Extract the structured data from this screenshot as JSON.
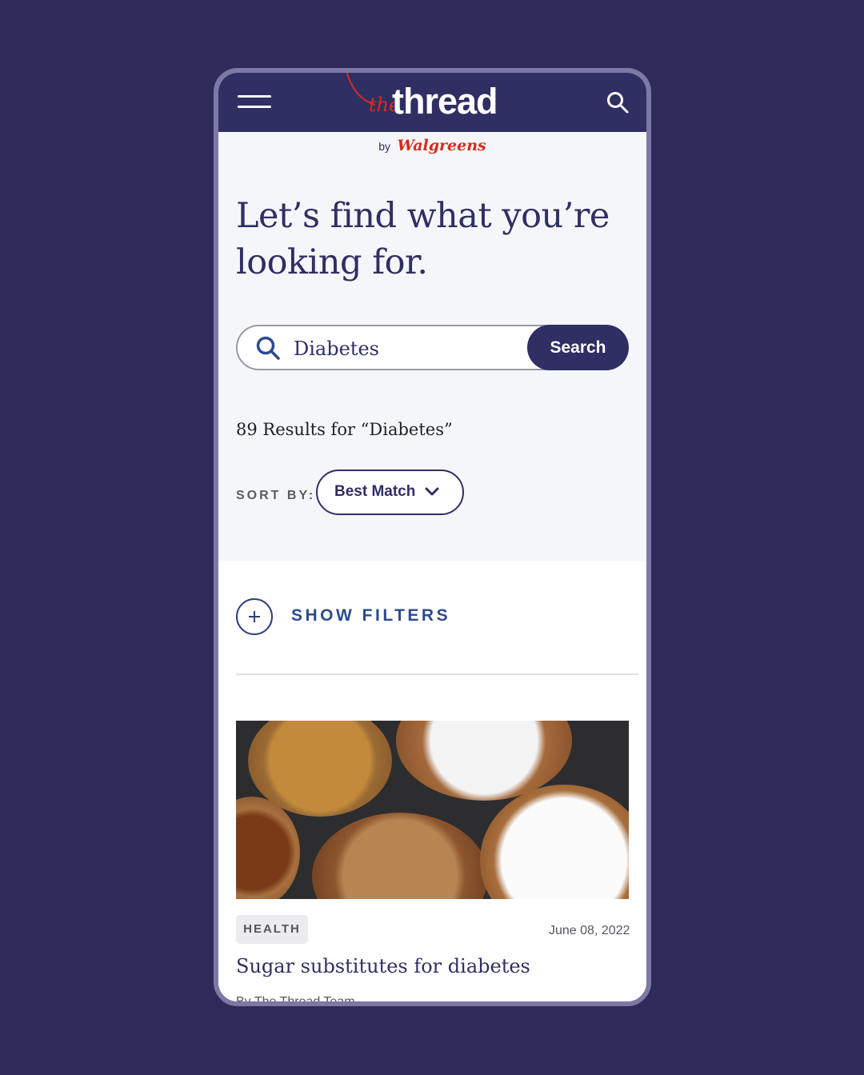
{
  "header": {
    "logo_prefix": "the",
    "logo_main": "thread",
    "byline_by": "by",
    "byline_brand": "Walgreens"
  },
  "main": {
    "headline": "Let’s find what you’re looking for.",
    "search": {
      "value": "Diabetes",
      "button_label": "Search"
    },
    "results_text": "89 Results for “Diabetes”",
    "sort": {
      "label": "SORT BY:",
      "selected": "Best Match"
    },
    "filters_label": "SHOW FILTERS"
  },
  "card": {
    "tag": "HEALTH",
    "date": "June 08, 2022",
    "title": "Sugar substitutes for diabetes",
    "author": "By The Thread Team"
  },
  "colors": {
    "background": "#2e2b58",
    "brand_navy": "#2f2f63",
    "brand_red": "#d52b1e",
    "frame": "#7b7aa6"
  },
  "icons": {
    "menu": "hamburger-menu-icon",
    "search": "search-icon",
    "sort": "chevron-down-icon",
    "filters": "plus-icon"
  }
}
